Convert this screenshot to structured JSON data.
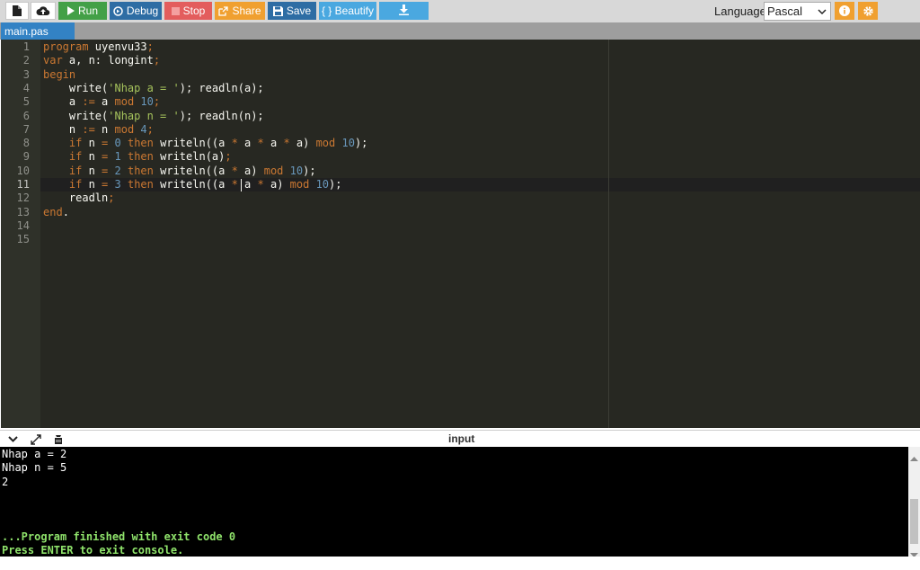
{
  "toolbar": {
    "run_label": "Run",
    "debug_label": "Debug",
    "stop_label": "Stop",
    "share_label": "Share",
    "save_label": "Save",
    "beautify_label": "{ } Beautify",
    "language_label": "Language",
    "language_value": "Pascal",
    "colors": {
      "run": "#43a047",
      "debug": "#2e6da4",
      "stop": "#e35d5d",
      "share": "#f0a030",
      "save": "#2e6da4",
      "beautify": "#4aa8e0",
      "download": "#4aa8e0",
      "info": "#f0a030",
      "settings": "#f0a030"
    }
  },
  "tab": {
    "name": "main.pas"
  },
  "editor": {
    "lines": [
      [
        {
          "t": "program",
          "c": "kw"
        },
        {
          "t": " uyenvu33",
          "c": "tok"
        },
        {
          "t": ";",
          "c": "kw"
        }
      ],
      [
        {
          "t": "var",
          "c": "kw"
        },
        {
          "t": " a, n: longint",
          "c": "tok"
        },
        {
          "t": ";",
          "c": "kw"
        }
      ],
      [
        {
          "t": "begin",
          "c": "kw"
        }
      ],
      [
        {
          "t": "    write(",
          "c": "tok"
        },
        {
          "t": "'Nhap a = '",
          "c": "str"
        },
        {
          "t": "); readln(a);",
          "c": "tok"
        }
      ],
      [
        {
          "t": "    a ",
          "c": "tok"
        },
        {
          "t": ":=",
          "c": "kw"
        },
        {
          "t": " a ",
          "c": "tok"
        },
        {
          "t": "mod",
          "c": "kw"
        },
        {
          "t": " ",
          "c": "tok"
        },
        {
          "t": "10",
          "c": "num"
        },
        {
          "t": ";",
          "c": "kw"
        }
      ],
      [
        {
          "t": "    write(",
          "c": "tok"
        },
        {
          "t": "'Nhap n = '",
          "c": "str"
        },
        {
          "t": "); readln(n);",
          "c": "tok"
        }
      ],
      [
        {
          "t": "    n ",
          "c": "tok"
        },
        {
          "t": ":=",
          "c": "kw"
        },
        {
          "t": " n ",
          "c": "tok"
        },
        {
          "t": "mod",
          "c": "kw"
        },
        {
          "t": " ",
          "c": "tok"
        },
        {
          "t": "4",
          "c": "num"
        },
        {
          "t": ";",
          "c": "kw"
        }
      ],
      [
        {
          "t": "    ",
          "c": "tok"
        },
        {
          "t": "if",
          "c": "kw"
        },
        {
          "t": " n ",
          "c": "tok"
        },
        {
          "t": "=",
          "c": "kw"
        },
        {
          "t": " ",
          "c": "tok"
        },
        {
          "t": "0",
          "c": "num"
        },
        {
          "t": " ",
          "c": "tok"
        },
        {
          "t": "then",
          "c": "kw"
        },
        {
          "t": " writeln((a ",
          "c": "tok"
        },
        {
          "t": "*",
          "c": "kw"
        },
        {
          "t": " a ",
          "c": "tok"
        },
        {
          "t": "*",
          "c": "kw"
        },
        {
          "t": " a ",
          "c": "tok"
        },
        {
          "t": "*",
          "c": "kw"
        },
        {
          "t": " a) ",
          "c": "tok"
        },
        {
          "t": "mod",
          "c": "kw"
        },
        {
          "t": " ",
          "c": "tok"
        },
        {
          "t": "10",
          "c": "num"
        },
        {
          "t": ");",
          "c": "tok"
        }
      ],
      [
        {
          "t": "    ",
          "c": "tok"
        },
        {
          "t": "if",
          "c": "kw"
        },
        {
          "t": " n ",
          "c": "tok"
        },
        {
          "t": "=",
          "c": "kw"
        },
        {
          "t": " ",
          "c": "tok"
        },
        {
          "t": "1",
          "c": "num"
        },
        {
          "t": " ",
          "c": "tok"
        },
        {
          "t": "then",
          "c": "kw"
        },
        {
          "t": " writeln(a)",
          "c": "tok"
        },
        {
          "t": ";",
          "c": "kw"
        }
      ],
      [
        {
          "t": "    ",
          "c": "tok"
        },
        {
          "t": "if",
          "c": "kw"
        },
        {
          "t": " n ",
          "c": "tok"
        },
        {
          "t": "=",
          "c": "kw"
        },
        {
          "t": " ",
          "c": "tok"
        },
        {
          "t": "2",
          "c": "num"
        },
        {
          "t": " ",
          "c": "tok"
        },
        {
          "t": "then",
          "c": "kw"
        },
        {
          "t": " writeln((a ",
          "c": "tok"
        },
        {
          "t": "*",
          "c": "kw"
        },
        {
          "t": " a) ",
          "c": "tok"
        },
        {
          "t": "mod",
          "c": "kw"
        },
        {
          "t": " ",
          "c": "tok"
        },
        {
          "t": "10",
          "c": "num"
        },
        {
          "t": ");",
          "c": "tok"
        }
      ],
      [
        {
          "t": "    ",
          "c": "tok"
        },
        {
          "t": "if",
          "c": "kw"
        },
        {
          "t": " n ",
          "c": "tok"
        },
        {
          "t": "=",
          "c": "kw"
        },
        {
          "t": " ",
          "c": "tok"
        },
        {
          "t": "3",
          "c": "num"
        },
        {
          "t": " ",
          "c": "tok"
        },
        {
          "t": "then",
          "c": "kw"
        },
        {
          "t": " writeln((a ",
          "c": "tok"
        },
        {
          "t": "*",
          "c": "kw"
        },
        {
          "t": " a ",
          "c": "tok"
        },
        {
          "t": "*",
          "c": "kw"
        },
        {
          "t": " a) ",
          "c": "tok"
        },
        {
          "t": "mod",
          "c": "kw"
        },
        {
          "t": " ",
          "c": "tok"
        },
        {
          "t": "10",
          "c": "num"
        },
        {
          "t": ");",
          "c": "tok"
        }
      ],
      [
        {
          "t": "    readln",
          "c": "tok"
        },
        {
          "t": ";",
          "c": "kw"
        }
      ],
      [
        {
          "t": "end",
          "c": "kw"
        },
        {
          "t": ".",
          "c": "tok"
        }
      ],
      [],
      []
    ],
    "line_numbers": [
      "1",
      "2",
      "3",
      "4",
      "5",
      "6",
      "7",
      "8",
      "9",
      "10",
      "11",
      "12",
      "13",
      "14",
      "15"
    ],
    "active_line": 11
  },
  "console": {
    "title": "input",
    "output_lines": [
      "Nhap a = 2",
      "Nhap n = 5",
      "2",
      "",
      "",
      "",
      "...Program finished with exit code 0",
      "Press ENTER to exit console."
    ],
    "green_lines": [
      6,
      7
    ]
  }
}
